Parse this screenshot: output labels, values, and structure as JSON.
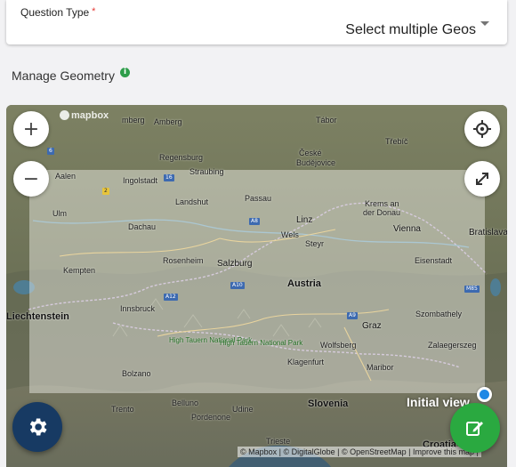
{
  "question": {
    "label": "Question Type",
    "required_mark": "*",
    "selected": "Select multiple Geos"
  },
  "section": {
    "title": "Manage Geometry",
    "info_icon": "info-icon"
  },
  "map": {
    "logo": "mapbox",
    "initial_view_label": "Initial view",
    "attribution": "© Mapbox | © DigitalGlobe | © OpenStreetMap | Improve this map |",
    "controls": {
      "zoom_in": "+",
      "zoom_out": "−",
      "locate_icon": "crosshair-icon",
      "fullscreen_icon": "expand-icon"
    },
    "places": {
      "country": "Austria",
      "nurnberg": "mberg",
      "amberg": "Amberg",
      "regensburg": "Regensburg",
      "straubing": "Straubing",
      "ceske": "České",
      "budejovice": "Budějovice",
      "trebic": "Třebíč",
      "tabor": "Tábor",
      "aalen": "Aalen",
      "ingolstadt": "Ingolstadt",
      "landshut": "Landshut",
      "passau": "Passau",
      "krems1": "Krems an",
      "krems2": "der Donau",
      "ulm": "Ulm",
      "dachau": "Dachau",
      "linz": "Linz",
      "wels": "Wels",
      "steyr": "Steyr",
      "vienna": "Vienna",
      "bratislava": "Bratislava",
      "kempten": "Kempten",
      "rosenheim": "Rosenheim",
      "salzburg": "Salzburg",
      "eisenstadt": "Eisenstadt",
      "liechtenstein": "Liechtenstein",
      "innsbruck": "Innsbruck",
      "szombathely": "Szombathely",
      "graz": "Graz",
      "wolfsberg": "Wolfsberg",
      "zalaegerszeg": "Zalaegerszeg",
      "klagenfurt": "Klagenfurt",
      "maribor": "Maribor",
      "park1": "High Tauern National Park",
      "park2": "High Tauern National Park",
      "bolzano": "Bolzano",
      "trento": "Trento",
      "belluno": "Belluno",
      "slovenia": "Slovenia",
      "udine": "Udine",
      "pordenone": "Pordenone",
      "trieste": "Trieste",
      "croatia": "Croatia"
    },
    "roads": {
      "a8": "A8",
      "a10": "A10",
      "a12": "A12",
      "a9": "A9",
      "m85": "M85",
      "r16": "16",
      "r2": "2",
      "r6": "6"
    },
    "colors": {
      "view_overlay": "rgba(255,255,250,0.42)",
      "location_dot": "#1e88e5"
    }
  },
  "fabs": {
    "settings_icon": "gear-icon",
    "edit_icon": "edit-icon",
    "settings_color": "#173a63",
    "edit_color": "#2aa940"
  }
}
